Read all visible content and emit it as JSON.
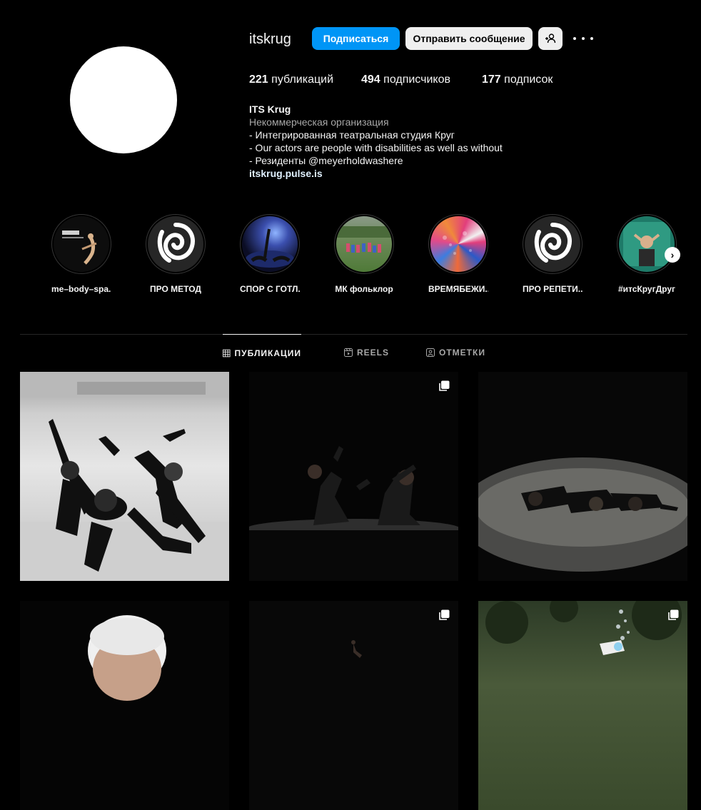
{
  "profile": {
    "username": "itskrug",
    "follow_label": "Подписаться",
    "message_label": "Отправить сообщение",
    "stats": [
      {
        "count": "221",
        "label": " публикаций"
      },
      {
        "count": "494",
        "label": " подписчиков"
      },
      {
        "count": "177",
        "label": " подписок"
      }
    ],
    "bio": {
      "name": "ITS Krug",
      "category": "Некоммерческая организация",
      "lines": [
        "- Интегрированная театральная студия Круг",
        "- Our actors are people with disabilities as well as without",
        "- Резиденты @meyerholdwashere"
      ],
      "link": "itskrug.pulse.is"
    }
  },
  "highlights": [
    {
      "label": "me–body–spa...",
      "icon": "dance-photo"
    },
    {
      "label": "ПРО МЕТОД",
      "icon": "spiral-logo"
    },
    {
      "label": "СПОР С ГОТЛ...",
      "icon": "stage-photo"
    },
    {
      "label": "МК фольклор",
      "icon": "outdoor-photo"
    },
    {
      "label": "ВРЕМЯБЕЖИ...",
      "icon": "colorful-photo"
    },
    {
      "label": "ПРО РЕПЕТИ...",
      "icon": "spiral-logo"
    },
    {
      "label": "#итсКругДруг",
      "icon": "portrait-photo"
    }
  ],
  "tabs": [
    {
      "label": "ПУБЛИКАЦИИ",
      "icon": "grid-icon",
      "active": true
    },
    {
      "label": "REELS",
      "icon": "reels-icon",
      "active": false
    },
    {
      "label": "ОТМЕТКИ",
      "icon": "tagged-icon",
      "active": false
    }
  ],
  "posts": [
    {
      "type": "single",
      "scene": "bw-dancers-rehearsal"
    },
    {
      "type": "carousel",
      "scene": "two-dancers-dark-stage"
    },
    {
      "type": "single",
      "scene": "dancers-lying-stage"
    },
    {
      "type": "single",
      "scene": "portrait"
    },
    {
      "type": "carousel",
      "scene": "dark-stage"
    },
    {
      "type": "carousel",
      "scene": "outdoor-performance"
    }
  ],
  "colors": {
    "accent": "#0095f6",
    "background": "#000000",
    "secondary_text": "#a8a8a8"
  }
}
